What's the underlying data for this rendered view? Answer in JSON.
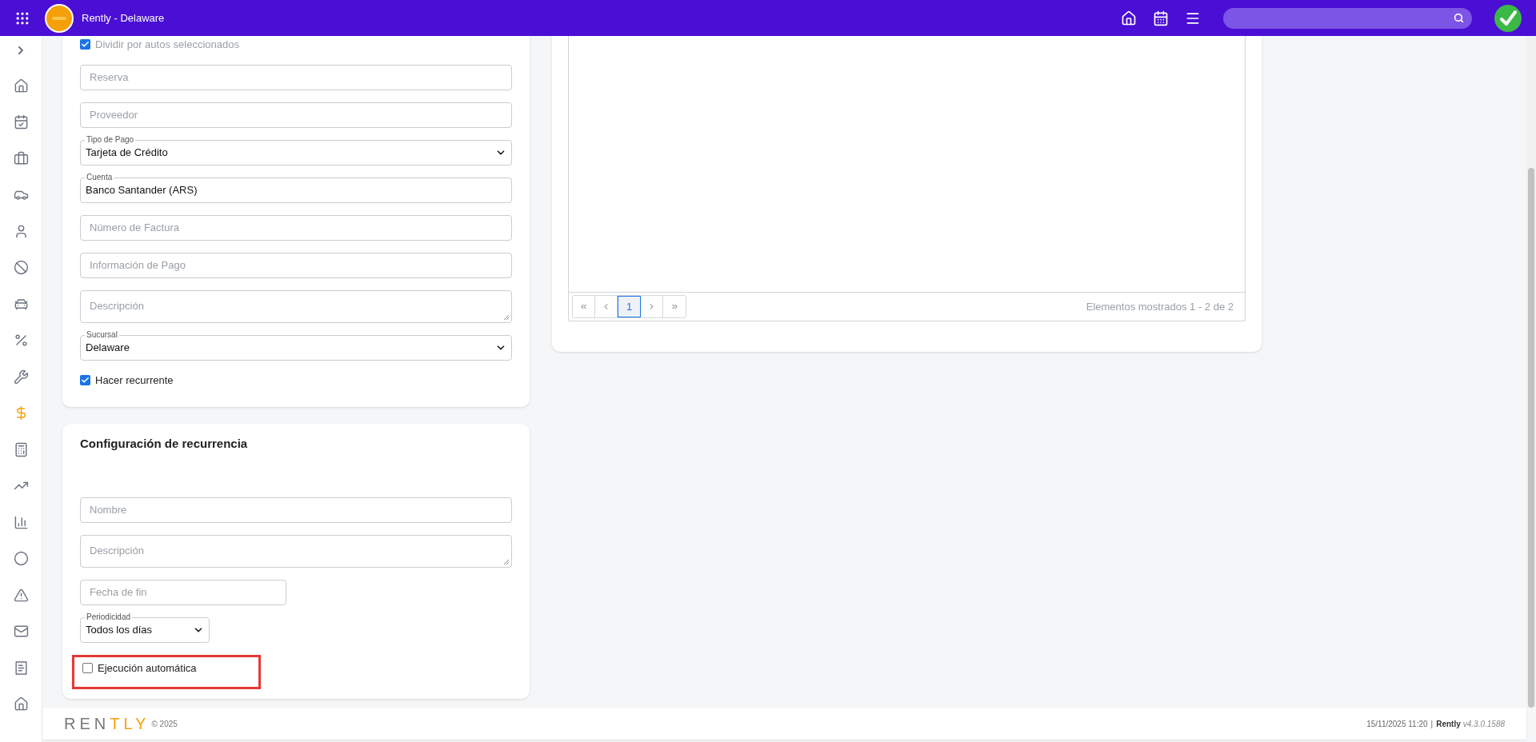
{
  "header": {
    "title": "Rently - Delaware"
  },
  "sidebar": {
    "items": [
      {
        "selected": false
      },
      {
        "selected": false
      },
      {
        "selected": false
      },
      {
        "selected": false
      },
      {
        "selected": false
      },
      {
        "selected": false
      },
      {
        "selected": false
      },
      {
        "selected": false
      },
      {
        "selected": false
      },
      {
        "selected": false
      },
      {
        "selected": true
      },
      {
        "selected": false
      },
      {
        "selected": false
      },
      {
        "selected": false
      },
      {
        "selected": false
      },
      {
        "selected": false
      },
      {
        "selected": false
      },
      {
        "selected": false
      },
      {
        "selected": false
      }
    ]
  },
  "expense_form": {
    "fields": [
      {
        "kind": "checkbox",
        "label": "Dividir por autos seleccionados",
        "checked": true,
        "muted": true
      },
      {
        "kind": "input",
        "placeholder": "Reserva"
      },
      {
        "kind": "input",
        "placeholder": "Proveedor"
      },
      {
        "kind": "select",
        "label": "Tipo de Pago",
        "value": "Tarjeta de Crédito"
      },
      {
        "kind": "input",
        "label": "Cuenta",
        "value": "Banco Santander (ARS)"
      },
      {
        "kind": "input",
        "placeholder": "Número de Factura"
      },
      {
        "kind": "input",
        "placeholder": "Información de Pago"
      },
      {
        "kind": "textarea",
        "placeholder": "Descripción"
      },
      {
        "kind": "select",
        "label": "Sucursal",
        "value": "Delaware"
      },
      {
        "kind": "checkbox",
        "label": "Hacer recurrente",
        "checked": true
      }
    ]
  },
  "recurrence": {
    "title": "Configuración de recurrencia",
    "fields": [
      {
        "kind": "input",
        "placeholder": "Nombre"
      },
      {
        "kind": "textarea",
        "placeholder": "Descripción"
      },
      {
        "kind": "input",
        "placeholder": "Fecha de fin"
      },
      {
        "kind": "select",
        "label": "Periodicidad",
        "value": "Todos los días"
      },
      {
        "kind": "checkbox",
        "label": "Ejecución automática",
        "checked": false,
        "highlighted": true
      }
    ]
  },
  "grid": {
    "pager": {
      "pages": [
        {
          "label": "1",
          "selected": true
        }
      ],
      "summary": "Elementos mostrados 1 - 2 de 2"
    }
  },
  "footer": {
    "logo": {
      "dark": "REN",
      "accent": "TLY"
    },
    "copyright": "© 2025",
    "datetime": "15/11/2025 11:20",
    "separator": "|",
    "brand": "Rently",
    "version": "v4.3.0.1588"
  }
}
